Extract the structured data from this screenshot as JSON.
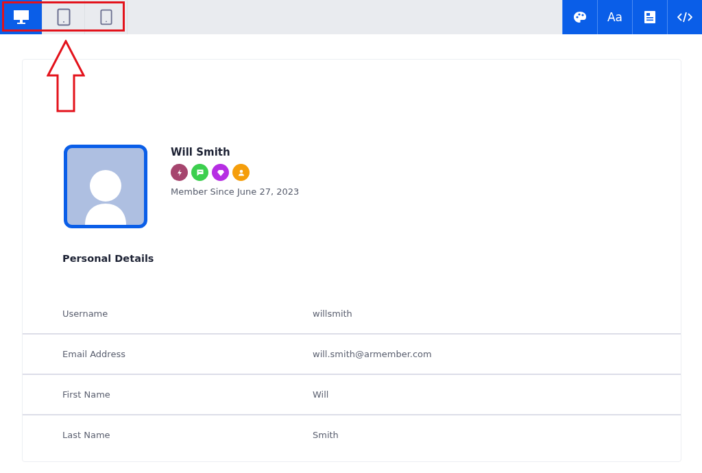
{
  "devices": [
    {
      "kind": "desktop",
      "selected": true
    },
    {
      "kind": "tablet",
      "selected": false
    },
    {
      "kind": "mobile",
      "selected": false
    }
  ],
  "tools": [
    {
      "kind": "palette"
    },
    {
      "kind": "font",
      "label": "Aa"
    },
    {
      "kind": "form"
    },
    {
      "kind": "code"
    }
  ],
  "profile": {
    "name": "Will Smith",
    "badges": [
      {
        "kind": "bolt",
        "color": "#a6456e"
      },
      {
        "kind": "chat",
        "color": "#3ccf4e"
      },
      {
        "kind": "diamond",
        "color": "#b62ee3"
      },
      {
        "kind": "user",
        "color": "#f59e0b"
      }
    ],
    "member_since": "Member Since June 27, 2023"
  },
  "section_title": "Personal Details",
  "details": [
    {
      "label": "Username",
      "value": "willsmith"
    },
    {
      "label": "Email Address",
      "value": "will.smith@armember.com"
    },
    {
      "label": "First Name",
      "value": "Will"
    },
    {
      "label": "Last Name",
      "value": "Smith"
    }
  ]
}
